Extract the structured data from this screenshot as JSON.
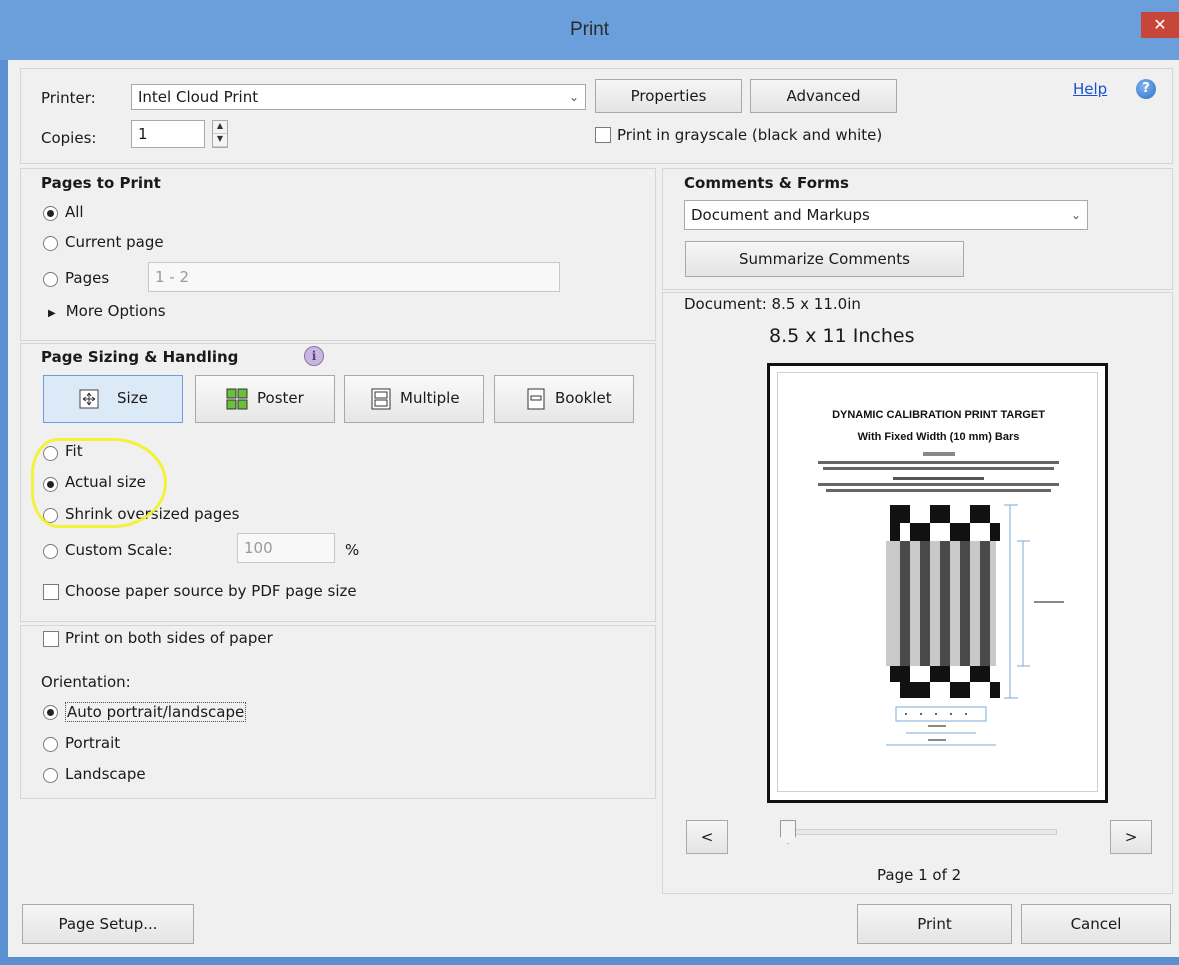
{
  "window": {
    "title": "Print",
    "close_glyph": "✕"
  },
  "header": {
    "printer_label": "Printer:",
    "printer_value": "Intel Cloud Print",
    "copies_label": "Copies:",
    "copies_value": "1",
    "properties_label": "Properties",
    "advanced_label": "Advanced",
    "help_label": "Help",
    "grayscale_label": "Print in grayscale (black and white)",
    "grayscale_checked": false
  },
  "pages_to_print": {
    "heading": "Pages to Print",
    "options": [
      {
        "label": "All",
        "selected": true
      },
      {
        "label": "Current page",
        "selected": false
      },
      {
        "label": "Pages",
        "selected": false
      }
    ],
    "pages_range": "1 - 2",
    "more_options_label": "More Options"
  },
  "sizing": {
    "heading": "Page Sizing & Handling",
    "tabs": [
      {
        "label": "Size",
        "selected": true
      },
      {
        "label": "Poster",
        "selected": false
      },
      {
        "label": "Multiple",
        "selected": false
      },
      {
        "label": "Booklet",
        "selected": false
      }
    ],
    "options": [
      {
        "label": "Fit",
        "selected": false
      },
      {
        "label": "Actual size",
        "selected": true
      },
      {
        "label": "Shrink oversized pages",
        "selected": false
      },
      {
        "label": "Custom Scale:",
        "selected": false
      }
    ],
    "custom_scale_value": "100",
    "percent_label": "%",
    "paper_source_label": "Choose paper source by PDF page size"
  },
  "duplex": {
    "both_sides_label": "Print on both sides of paper",
    "orientation_label": "Orientation:",
    "options": [
      {
        "label": "Auto portrait/landscape",
        "selected": true
      },
      {
        "label": "Portrait",
        "selected": false
      },
      {
        "label": "Landscape",
        "selected": false
      }
    ]
  },
  "comments_forms": {
    "heading": "Comments & Forms",
    "selected": "Document and Markups",
    "summarize_label": "Summarize Comments"
  },
  "preview": {
    "document_size_label": "Document: 8.5 x 11.0in",
    "page_size_label": "8.5 x 11 Inches",
    "page_title": "DYNAMIC CALIBRATION PRINT TARGET",
    "page_subtitle": "With Fixed Width (10 mm) Bars",
    "prev_label": "<",
    "next_label": ">",
    "page_indicator": "Page 1 of 2"
  },
  "footer": {
    "page_setup_label": "Page Setup...",
    "print_label": "Print",
    "cancel_label": "Cancel"
  }
}
